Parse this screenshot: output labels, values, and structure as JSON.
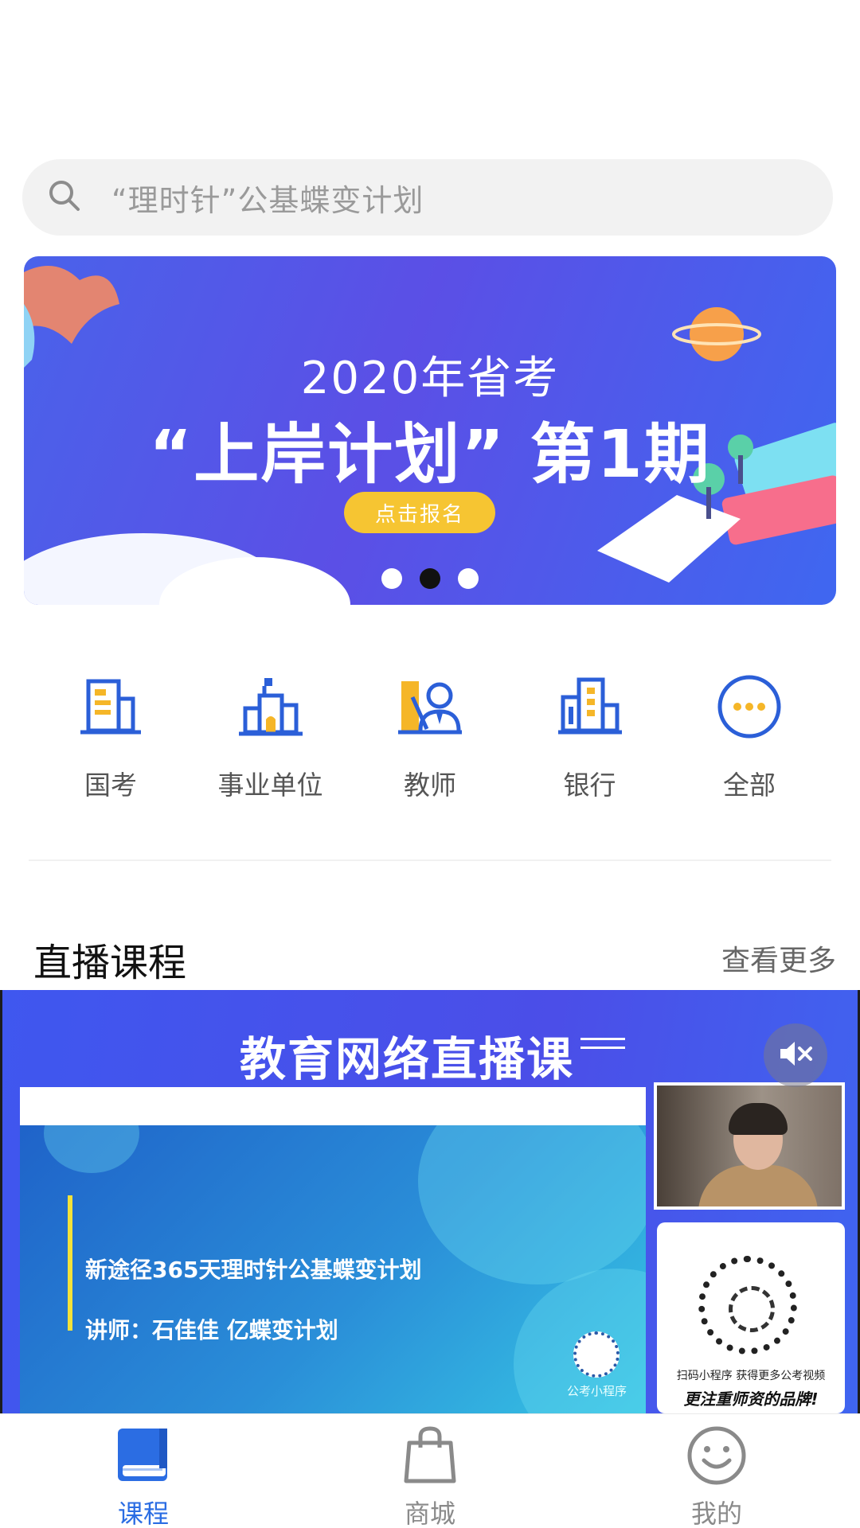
{
  "search": {
    "placeholder": "“理时针”公基蝶变计划"
  },
  "banner": {
    "line1": "2020年省考",
    "line2": "“上岸计划” 第1期",
    "button": "点击报名",
    "pages": 3,
    "active_page": 2
  },
  "categories": [
    {
      "label": "国考",
      "icon": "building-icon"
    },
    {
      "label": "事业单位",
      "icon": "city-hall-icon"
    },
    {
      "label": "教师",
      "icon": "teacher-icon"
    },
    {
      "label": "银行",
      "icon": "bank-building-icon"
    },
    {
      "label": "全部",
      "icon": "more-dots-icon"
    }
  ],
  "live_section": {
    "title": "直播课程",
    "more": "查看更多",
    "player": {
      "banner_title": "教育网络直播课",
      "slide_line1": "新途径365天理时针公基蝶变计划",
      "slide_line2": "讲师：石佳佳 亿蝶变计划",
      "miniprogram_label": "公考小程序",
      "qr_caption": "扫码小程序 获得更多公考视频",
      "qr_slogan": "更注重师资的品牌!",
      "muted": true
    }
  },
  "tabbar": [
    {
      "label": "课程",
      "icon": "book-icon",
      "active": true
    },
    {
      "label": "商城",
      "icon": "shopping-bag-icon",
      "active": false
    },
    {
      "label": "我的",
      "icon": "smiley-face-icon",
      "active": false
    }
  ],
  "colors": {
    "accent": "#2b6de3",
    "icon_blue": "#2b5fd8",
    "icon_yellow": "#f5b628",
    "banner_button": "#f6c532"
  }
}
